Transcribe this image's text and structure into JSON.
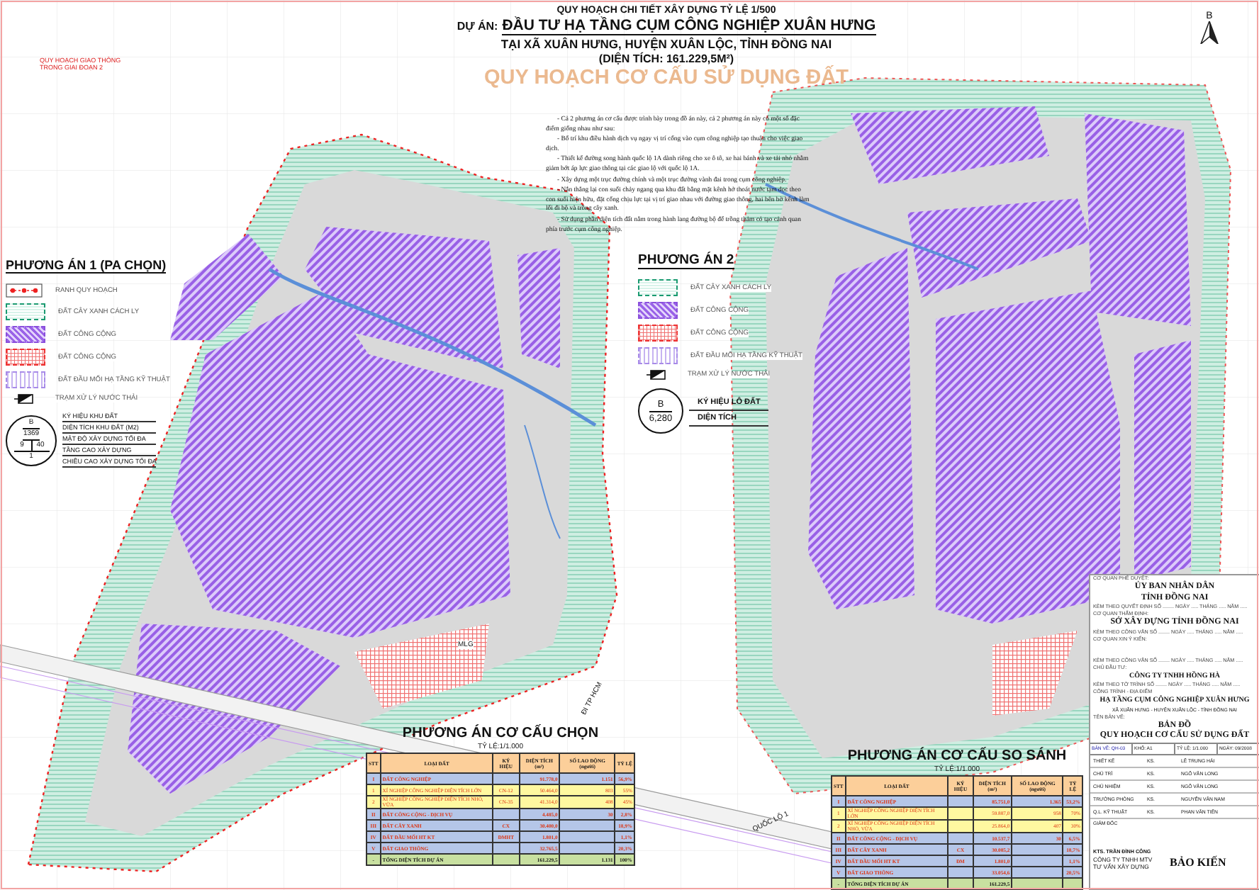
{
  "header": {
    "subtitle": "QUY HOẠCH CHI TIẾT XÂY DỰNG TỶ LỆ 1/500",
    "project_label": "DỰ ÁN:",
    "project_name": "ĐẦU TƯ HẠ TẦNG CỤM CÔNG NGHIỆP XUÂN HƯNG",
    "location": "TẠI XÃ XUÂN HƯNG, HUYỆN XUÂN LỘC, TỈNH ĐỒNG NAI",
    "area": "(DIỆN TÍCH: 161.229,5M²)",
    "map_title": "QUY HOẠCH CƠ CẤU SỬ DỤNG ĐẤT"
  },
  "north_label": "B",
  "map_labels": {
    "phase_note": "QUY HOẠCH GIAO THÔNG TRONG GIAI ĐOẠN 2",
    "junction": "MLG",
    "direction": "ĐI TP HCM",
    "highway": "QUỐC LỘ 1"
  },
  "legend_1": {
    "title": "PHƯƠNG ÁN 1 (PA CHỌN)",
    "items": [
      {
        "kind": "boundary",
        "label": "RANH QUY HOẠCH"
      },
      {
        "kind": "green",
        "label": "ĐẤT CÂY XANH CÁCH LY"
      },
      {
        "kind": "industrial",
        "label": "ĐẤT CÔNG CỘNG"
      },
      {
        "kind": "public",
        "label": "ĐẤT CÔNG CỘNG"
      },
      {
        "kind": "utility",
        "label": "ĐẤT ĐẦU MỐI HẠ TẦNG KỸ THUẬT"
      },
      {
        "kind": "wastewater",
        "label": "TRẠM XỬ LÝ NƯỚC THẢI"
      }
    ],
    "symbol_values": [
      "B",
      "1369",
      "9",
      "40",
      "1"
    ],
    "symbol_labels": [
      "KÝ HIỆU KHU ĐẤT",
      "DIỆN TÍCH KHU ĐẤT (M2)",
      "MẬT ĐỘ XÂY DỰNG TỐI ĐA",
      "TẦNG CAO XÂY DỰNG",
      "CHIỀU CAO XÂY DỰNG TỐI ĐA"
    ]
  },
  "notes": [
    "- Cả 2 phương án cơ cấu được trình bày trong đồ án này, cả 2 phương án này có một số đặc điểm giống nhau như sau:",
    "- Bố trí khu điều hành dịch vụ ngay vị trí cổng vào cụm công nghiệp tạo thuận cho việc giao dịch.",
    "- Thiết kế đường song hành quốc lộ 1A dành riêng cho xe ô tô, xe hai bánh và xe tải nhỏ nhằm giảm bớt áp lực giao thông tại các giao lộ với quốc lộ 1A.",
    "- Xây dựng một trục đường chính và một trục đường vành đai trong cụm công nghiệp.",
    "- Nắn thẳng lại con suối chảy ngang qua khu đất bằng mặt kênh hở thoát nước tạm dọc theo con suối hiện hữu, đặt cống chịu lực tại vị trí giao nhau với đường giao thông, hai bên bờ kênh làm lối đi bộ và trồng cây xanh.",
    "- Sử dụng phần diện tích đất nằm trong hành lang đường bộ để trồng thảm cỏ tạo cảnh quan phía trước cụm công nghiệp."
  ],
  "legend_2": {
    "title": "PHƯƠNG ÁN 2",
    "items": [
      {
        "kind": "green",
        "label": "ĐẤT CÂY XANH CÁCH LY"
      },
      {
        "kind": "industrial",
        "label": "ĐẤT CÔNG CỘNG"
      },
      {
        "kind": "public",
        "label": "ĐẤT CÔNG CỘNG"
      },
      {
        "kind": "utility",
        "label": "ĐẤT ĐẦU MỐI HẠ TẦNG KỸ THUẬT"
      },
      {
        "kind": "wastewater",
        "label": "TRẠM XỬ LÝ NƯỚC THẢI"
      }
    ],
    "symbol_values": [
      "B",
      "6,280"
    ],
    "symbol_labels": [
      "KÝ HIỆU LÔ ĐẤT",
      "DIỆN TÍCH"
    ]
  },
  "table_1": {
    "title": "PHƯƠNG ÁN CƠ CẤU CHỌN",
    "scale": "TỶ LỆ:1/1.000",
    "columns": [
      "STT",
      "LOẠI ĐẤT",
      "KÝ HIỆU",
      "DIỆN TÍCH (m²)",
      "SỐ LAO ĐỘNG (người)",
      "TỶ LỆ"
    ],
    "rows": [
      {
        "kind": "group",
        "cells": [
          "I",
          "ĐẤT CÔNG NGHIỆP",
          "",
          "91.778,0",
          "1.151",
          "56,9%"
        ]
      },
      {
        "kind": "item",
        "cells": [
          "1",
          "XÍ NGHIỆP CÔNG NGHIỆP DIỆN TÍCH LỚN",
          "CN-12",
          "50.464,0",
          "803",
          "55%"
        ]
      },
      {
        "kind": "item",
        "cells": [
          "2",
          "XÍ NGHIỆP CÔNG NGHIỆP DIỆN TÍCH NHỎ, VỪA",
          "CN-35",
          "41.314,0",
          "408",
          "45%"
        ]
      },
      {
        "kind": "group",
        "cells": [
          "II",
          "ĐẤT CÔNG CỘNG - DỊCH VỤ",
          "",
          "4.485,0",
          "30",
          "2,8%"
        ]
      },
      {
        "kind": "group",
        "cells": [
          "III",
          "ĐẤT CÂY XANH",
          "CX",
          "30.400,0",
          "",
          "18,9%"
        ]
      },
      {
        "kind": "group",
        "cells": [
          "IV",
          "ĐẤT ĐẦU MỐI HT KT",
          "ĐMHT",
          "1.801,0",
          "",
          "1,1%"
        ]
      },
      {
        "kind": "group",
        "cells": [
          "V",
          "ĐẤT GIAO THÔNG",
          "",
          "32.765,5",
          "",
          "20,3%"
        ]
      },
      {
        "kind": "total",
        "cells": [
          "-",
          "TỔNG DIỆN TÍCH DỰ ÁN",
          "",
          "161.229,5",
          "1.131",
          "100%"
        ]
      }
    ]
  },
  "table_2": {
    "title": "PHƯƠNG ÁN CƠ CẤU SO SÁNH",
    "scale": "TỶ LỆ:1/1.000",
    "columns": [
      "STT",
      "LOẠI ĐẤT",
      "KÝ HIỆU",
      "DIỆN TÍCH (m²)",
      "SỐ LAO ĐỘNG (người)",
      "TỶ LỆ"
    ],
    "rows": [
      {
        "kind": "group",
        "cells": [
          "I",
          "ĐẤT CÔNG NGHIỆP",
          "",
          "85.751,0",
          "1.365",
          "53,2%"
        ]
      },
      {
        "kind": "item",
        "cells": [
          "1",
          "XÍ NGHIỆP CÔNG NGHIỆP DIỆN TÍCH LỚN",
          "",
          "59.887,0",
          "958",
          "70%"
        ]
      },
      {
        "kind": "item",
        "cells": [
          "2",
          "XÍ NGHIỆP CÔNG NGHIỆP DIỆN TÍCH NHỎ, VỪA",
          "",
          "25.864,0",
          "407",
          "30%"
        ]
      },
      {
        "kind": "group",
        "cells": [
          "II",
          "ĐẤT CÔNG CỘNG - DỊCH VỤ",
          "",
          "10.537,7",
          "30",
          "6,5%"
        ]
      },
      {
        "kind": "group",
        "cells": [
          "III",
          "ĐẤT CÂY XANH",
          "CX",
          "30.085,2",
          "",
          "18,7%"
        ]
      },
      {
        "kind": "group",
        "cells": [
          "IV",
          "ĐẤT ĐẦU MỐI HT KT",
          "ĐM",
          "1.801,0",
          "",
          "1,1%"
        ]
      },
      {
        "kind": "group",
        "cells": [
          "V",
          "ĐẤT GIAO THÔNG",
          "",
          "33.054,6",
          "",
          "20,5%"
        ]
      },
      {
        "kind": "total",
        "cells": [
          "-",
          "TỔNG DIỆN TÍCH DỰ ÁN",
          "",
          "161.229,5",
          "",
          ""
        ]
      }
    ]
  },
  "title_block": {
    "rows": [
      {
        "kind": "caption",
        "text": "CƠ QUAN PHÊ DUYỆT:"
      },
      {
        "kind": "heading",
        "text": "ỦY BAN NHÂN DÂN"
      },
      {
        "kind": "heading",
        "text": "TỈNH ĐỒNG NAI"
      },
      {
        "kind": "caption",
        "text": "KÈM THEO QUYẾT ĐỊNH SỐ ........ NGÀY ..... THÁNG ..... NĂM ....."
      },
      {
        "kind": "caption",
        "text": "CƠ QUAN THẨM ĐỊNH:"
      },
      {
        "kind": "heading",
        "text": "SỞ XÂY DỰNG TỈNH ĐỒNG NAI"
      },
      {
        "kind": "caption",
        "text": "KÈM THEO CÔNG VĂN SỐ ........ NGÀY ..... THÁNG ..... NĂM ....."
      },
      {
        "kind": "caption",
        "text": "CƠ QUAN XIN Ý KIẾN:"
      },
      {
        "kind": "space",
        "text": "KÈM THEO CÔNG VĂN SỐ ........ NGÀY ..... THÁNG ..... NĂM ....."
      },
      {
        "kind": "caption",
        "text": "CHỦ ĐẦU TƯ:"
      },
      {
        "kind": "subheading",
        "text": "CÔNG TY TNHH HỒNG HÀ"
      },
      {
        "kind": "caption",
        "text": "KÈM THEO TỜ TRÌNH SỐ ........ NGÀY ..... THÁNG ..... NĂM ....."
      },
      {
        "kind": "caption",
        "text": "CÔNG TRÌNH - ĐỊA ĐIỂM"
      },
      {
        "kind": "subheading",
        "text": "HẠ TẦNG CỤM CÔNG NGHIỆP XUÂN HƯNG"
      },
      {
        "kind": "small",
        "text": "XÃ XUÂN HƯNG - HUYỆN XUÂN LỘC - TỈNH ĐỒNG NAI"
      },
      {
        "kind": "caption",
        "text": "TÊN BẢN VẼ:"
      },
      {
        "kind": "heading",
        "text": "BẢN ĐỒ"
      },
      {
        "kind": "heading",
        "text": "QUY HOẠCH CƠ CẤU SỬ DỤNG ĐẤT"
      }
    ],
    "sheet_info": [
      "BẢN VẼ: QH-03",
      "KHỔ: A1",
      "TỶ LỆ: 1/1.000",
      "NGÀY: 09/2008"
    ],
    "signatures": [
      {
        "role": "THIẾT KẾ",
        "title": "KS.",
        "name": "LÊ TRUNG HẢI"
      },
      {
        "role": "CHỦ TRÌ",
        "title": "KS.",
        "name": "NGÔ VĂN LONG"
      },
      {
        "role": "CHỦ NHIỆM",
        "title": "KS.",
        "name": "NGÔ VĂN LONG"
      },
      {
        "role": "TRƯỞNG PHÒNG",
        "title": "KS.",
        "name": "NGUYỄN VĂN NAM"
      },
      {
        "role": "Q.L. KỸ THUẬT",
        "title": "KS.",
        "name": "PHAN VĂN TIẾN"
      }
    ],
    "director_role": "GIÁM ĐỐC",
    "director_name": "KTS. TRẦN ĐÌNH CÔNG",
    "company": "CÔNG TY TNHH MTV TƯ VẤN XÂY DỰNG",
    "brand": "BẢO KIẾN"
  }
}
